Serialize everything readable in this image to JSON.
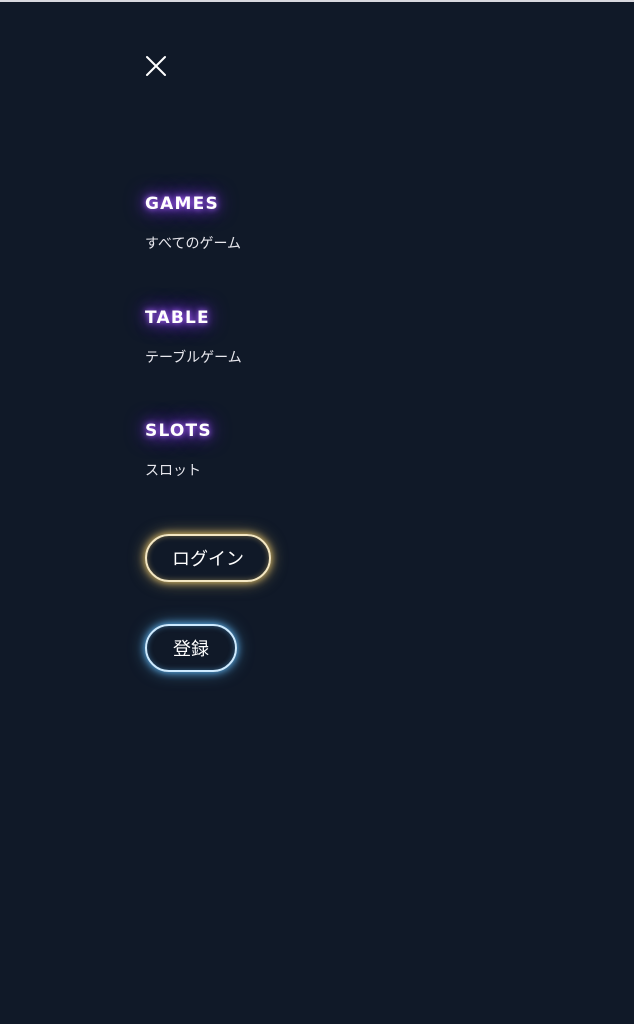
{
  "menu": {
    "sections": [
      {
        "title": "GAMES",
        "link": "すべてのゲーム"
      },
      {
        "title": "TABLE",
        "link": "テーブルゲーム"
      },
      {
        "title": "SLOTS",
        "link": "スロット"
      }
    ],
    "login_label": "ログイン",
    "register_label": "登録"
  },
  "colors": {
    "background": "#101928",
    "title_glow": "#b06bff",
    "login_glow": "#e7c46a",
    "register_glow": "#5fb4f0"
  },
  "icons": {
    "close": "close-icon"
  }
}
